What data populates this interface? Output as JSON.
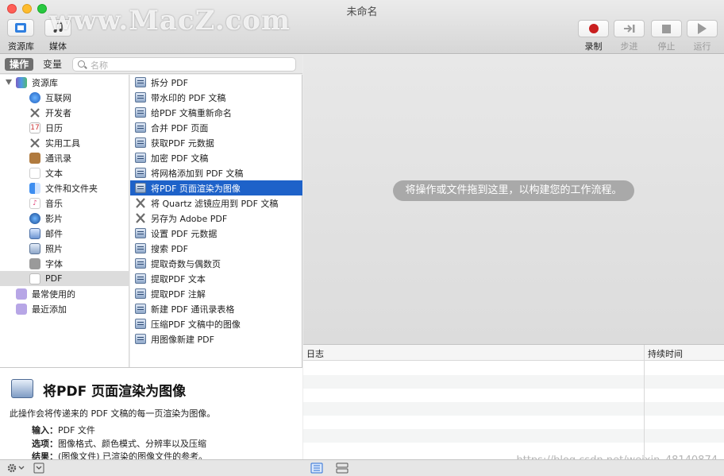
{
  "window": {
    "title": "未命名",
    "watermark": "www.MacZ.com"
  },
  "toolbar": {
    "library_label": "资源库",
    "media_label": "媒体",
    "record_label": "录制",
    "step_label": "步进",
    "stop_label": "停止",
    "run_label": "运行"
  },
  "panel_tabs": {
    "actions": "操作",
    "variables": "变量"
  },
  "search": {
    "placeholder": "名称"
  },
  "library": {
    "root": "资源库",
    "items": [
      {
        "label": "互联网",
        "icon": "globe-icon"
      },
      {
        "label": "开发者",
        "icon": "tools-icon"
      },
      {
        "label": "日历",
        "icon": "calendar-icon"
      },
      {
        "label": "实用工具",
        "icon": "tools-icon"
      },
      {
        "label": "通讯录",
        "icon": "contacts-icon"
      },
      {
        "label": "文本",
        "icon": "text-icon"
      },
      {
        "label": "文件和文件夹",
        "icon": "finder-icon"
      },
      {
        "label": "音乐",
        "icon": "music-icon"
      },
      {
        "label": "影片",
        "icon": "movie-icon"
      },
      {
        "label": "邮件",
        "icon": "mail-icon"
      },
      {
        "label": "照片",
        "icon": "photos-icon"
      },
      {
        "label": "字体",
        "icon": "font-icon"
      },
      {
        "label": "PDF",
        "icon": "pdf-icon"
      }
    ],
    "smart_groups": [
      "最常使用的",
      "最近添加"
    ]
  },
  "actions": [
    "拆分 PDF",
    "带水印的 PDF 文稿",
    "给PDF 文稿重新命名",
    "合并 PDF 页面",
    "获取PDF 元数据",
    "加密 PDF 文稿",
    "将网格添加到 PDF 文稿",
    "将PDF 页面渲染为图像",
    "将 Quartz 滤镜应用到 PDF 文稿",
    "另存为 Adobe PDF",
    "设置 PDF 元数据",
    "搜索 PDF",
    "提取奇数与偶数页",
    "提取PDF 文本",
    "提取PDF 注解",
    "新建 PDF 通讯录表格",
    "压缩PDF 文稿中的图像",
    "用图像新建 PDF"
  ],
  "description": {
    "title": "将PDF 页面渲染为图像",
    "body": "此操作会将传递来的 PDF 文稿的每一页渲染为图像。",
    "input_key": "输入：",
    "input_value": "PDF 文件",
    "options_key": "选项：",
    "options_value": "图像格式、颜色模式、分辨率以及压缩",
    "result_key": "结果：",
    "result_value": "(图像文件) 已渲染的图像文件的参考。"
  },
  "workflow": {
    "hint": "将操作或文件拖到这里，以构建您的工作流程。"
  },
  "log": {
    "col_log": "日志",
    "col_duration": "持续时间"
  },
  "footer": {
    "csdn": "https://blog.csdn.net/weixin_48140874"
  }
}
